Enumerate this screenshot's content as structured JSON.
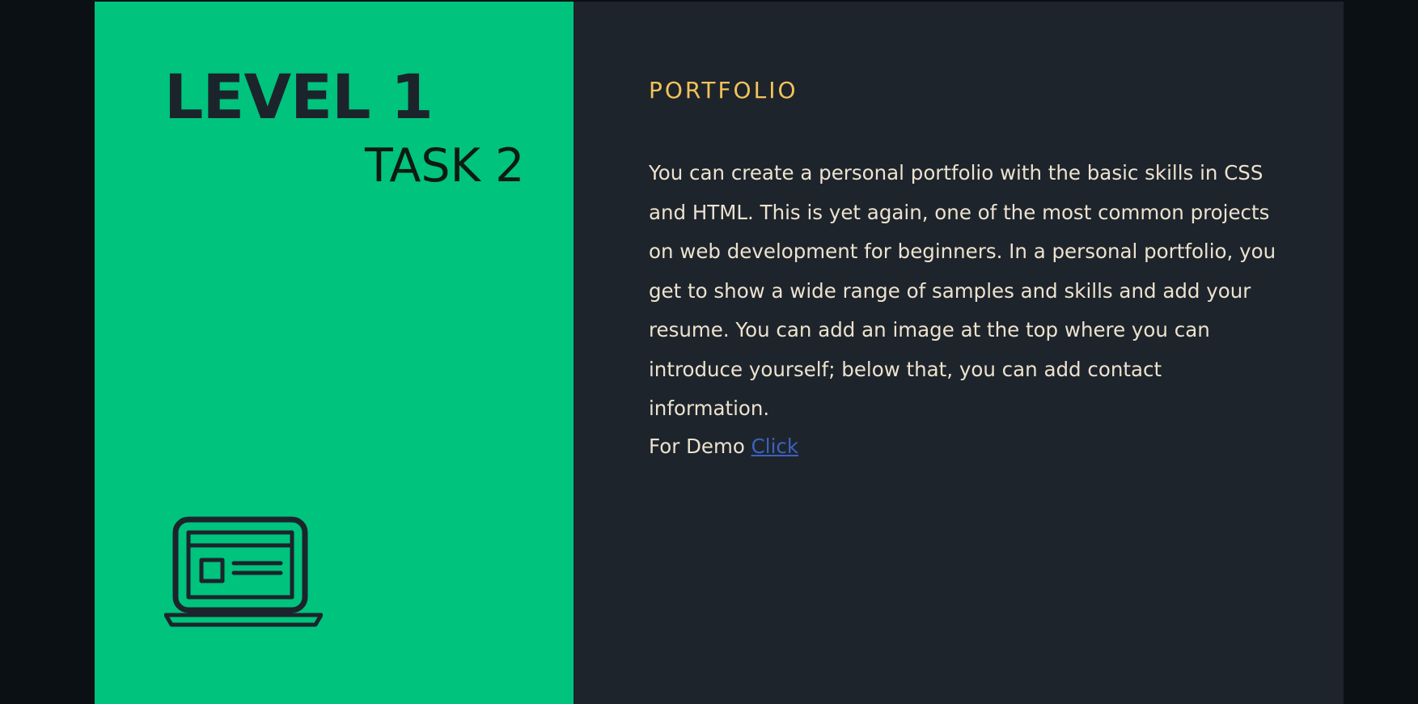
{
  "left_panel": {
    "level": "LEVEL 1",
    "task": "TASK 2",
    "icon": "laptop-icon"
  },
  "right_panel": {
    "heading": "PORTFOLIO",
    "description": "You can create a personal portfolio with the basic skills in CSS and HTML. This is yet again, one of the most common projects on web development for beginners. In a personal portfolio, you get to show a wide range of samples and skills and add your resume. You can add an image at the top where you can introduce yourself; below that, you can add contact information.",
    "demo_prefix": "For Demo ",
    "demo_link_label": "Click"
  },
  "colors": {
    "background": "#0b1015",
    "left_panel": "#00c37e",
    "right_panel": "#1e242b",
    "heading": "#f2c35a",
    "body_text": "#ece2cf",
    "link": "#3a63c0"
  }
}
